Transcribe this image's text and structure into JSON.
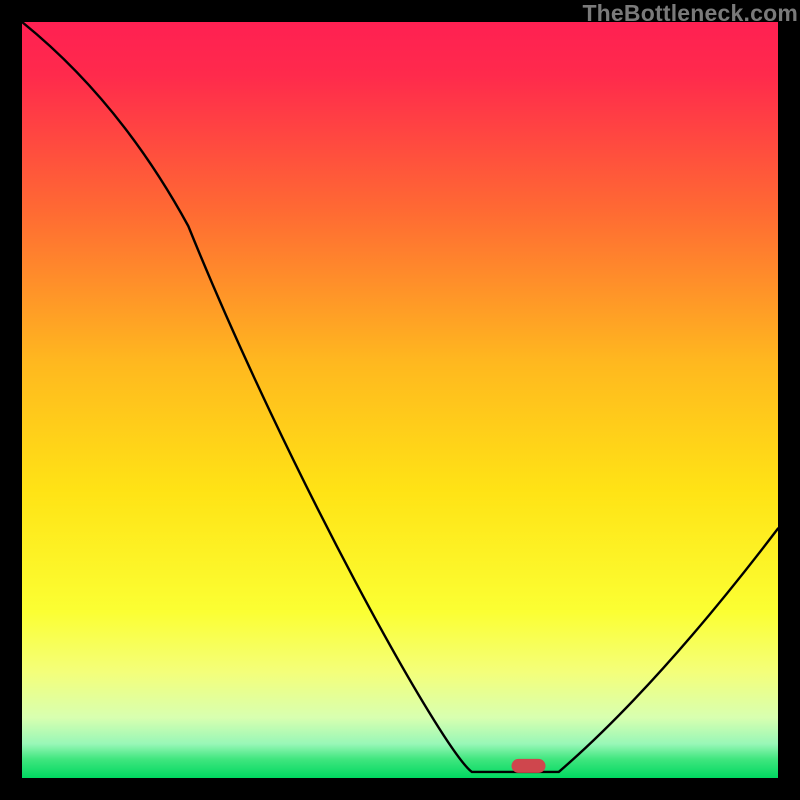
{
  "watermark": "TheBottleneck.com",
  "chart_data": {
    "type": "line",
    "title": "",
    "xlabel": "",
    "ylabel": "",
    "xlim": [
      0,
      100
    ],
    "ylim": [
      0,
      100
    ],
    "gradient_stops": [
      {
        "pos": 0.0,
        "color": "#ff2052"
      },
      {
        "pos": 0.07,
        "color": "#ff2a4c"
      },
      {
        "pos": 0.25,
        "color": "#ff6a33"
      },
      {
        "pos": 0.45,
        "color": "#ffb81f"
      },
      {
        "pos": 0.62,
        "color": "#ffe315"
      },
      {
        "pos": 0.78,
        "color": "#fbff33"
      },
      {
        "pos": 0.86,
        "color": "#f4ff7a"
      },
      {
        "pos": 0.92,
        "color": "#d8ffb0"
      },
      {
        "pos": 0.955,
        "color": "#98f7b7"
      },
      {
        "pos": 0.975,
        "color": "#40e67f"
      },
      {
        "pos": 1.0,
        "color": "#00d860"
      }
    ],
    "series": [
      {
        "name": "bottleneck-curve",
        "points": [
          {
            "x": 0,
            "y": 100
          },
          {
            "x": 22,
            "y": 73
          },
          {
            "x": 59.5,
            "y": 0.8
          },
          {
            "x": 71,
            "y": 0.8
          },
          {
            "x": 100,
            "y": 33
          }
        ]
      }
    ],
    "marker": {
      "x": 67,
      "y": 1.6,
      "color": "#cf464d",
      "label": "optimum-marker"
    }
  }
}
